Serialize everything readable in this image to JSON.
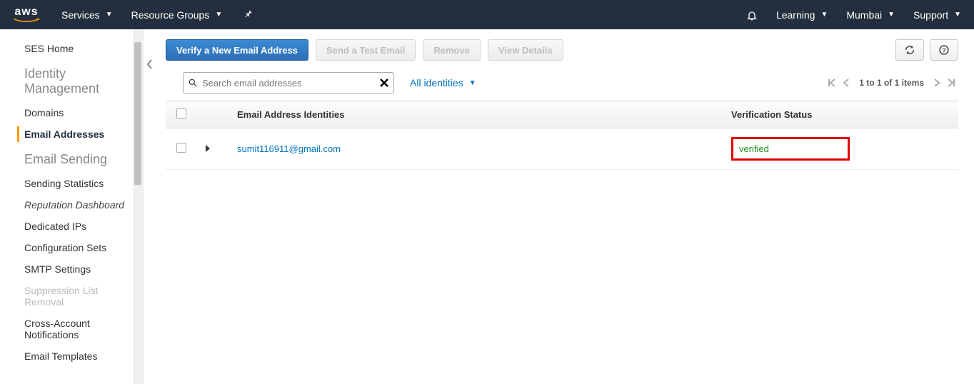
{
  "topnav": {
    "logo_text": "aws",
    "services": "Services",
    "resource_groups": "Resource Groups",
    "account": "Learning",
    "region": "Mumbai",
    "support": "Support"
  },
  "sidebar": {
    "home": "SES Home",
    "identity_heading": "Identity Management",
    "domains": "Domains",
    "email_addresses": "Email Addresses",
    "sending_heading": "Email Sending",
    "sending_stats": "Sending Statistics",
    "reputation": "Reputation Dashboard",
    "dedicated_ips": "Dedicated IPs",
    "config_sets": "Configuration Sets",
    "smtp": "SMTP Settings",
    "suppression": "Suppression List Removal",
    "cross_account": "Cross-Account Notifications",
    "templates": "Email Templates"
  },
  "toolbar": {
    "verify": "Verify a New Email Address",
    "send_test": "Send a Test Email",
    "remove": "Remove",
    "view_details": "View Details"
  },
  "filter": {
    "search_placeholder": "Search email addresses",
    "all_identities": "All identities",
    "pager_text": "1 to 1 of 1 items"
  },
  "table": {
    "col_email": "Email Address Identities",
    "col_status": "Verification Status",
    "rows": [
      {
        "email": "sumit116911@gmail.com",
        "status": "verified"
      }
    ]
  }
}
